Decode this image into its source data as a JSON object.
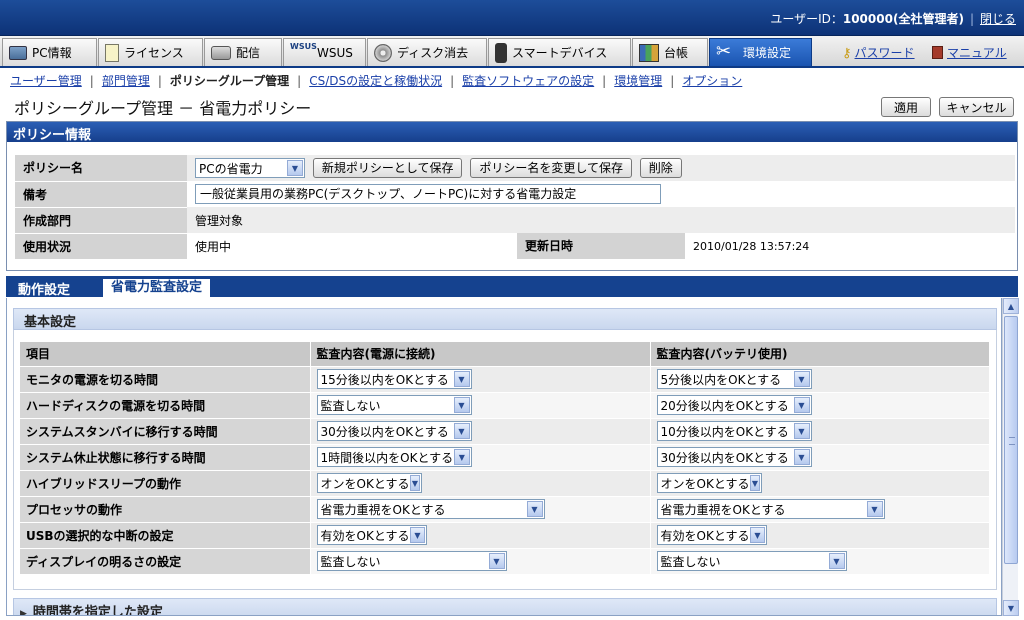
{
  "header": {
    "user_label": "ユーザーID：",
    "user_value": "100000(全社管理者)",
    "separator": "|",
    "close_label": "閉じる"
  },
  "tabs": [
    {
      "label": "PC情報",
      "icon": "pc-icon"
    },
    {
      "label": "ライセンス",
      "icon": "license-icon"
    },
    {
      "label": "配信",
      "icon": "distribution-icon"
    },
    {
      "label": "WSUS",
      "icon": "wsus-icon",
      "icon_text": "WSUS"
    },
    {
      "label": "ディスク消去",
      "icon": "disk-icon"
    },
    {
      "label": "スマートデバイス",
      "icon": "smart-device-icon"
    },
    {
      "label": "台帳",
      "icon": "ledger-icon"
    },
    {
      "label": "環境設定",
      "icon": "tools-icon",
      "active": true
    }
  ],
  "right_links": {
    "password": "パスワード",
    "manual": "マニュアル"
  },
  "subnav": {
    "items": [
      "ユーザー管理",
      "部門管理",
      "ポリシーグループ管理",
      "CS/DSの設定と稼働状況",
      "監査ソフトウェアの設定",
      "環境管理",
      "オプション"
    ],
    "current": "ポリシーグループ管理",
    "separator": "|"
  },
  "page": {
    "title": "ポリシーグループ管理 － 省電力ポリシー",
    "apply_label": "適用",
    "cancel_label": "キャンセル"
  },
  "policy_info": {
    "heading": "ポリシー情報",
    "name_label": "ポリシー名",
    "name_value": "PCの省電力",
    "save_new_label": "新規ポリシーとして保存",
    "rename_save_label": "ポリシー名を変更して保存",
    "delete_label": "削除",
    "remarks_label": "備考",
    "remarks_value": "一般従業員用の業務PC(デスクトップ、ノートPC)に対する省電力設定",
    "dept_label": "作成部門",
    "dept_value": "管理対象",
    "status_label": "使用状況",
    "status_value": "使用中",
    "updated_label": "更新日時",
    "updated_value": "2010/01/28 13:57:24"
  },
  "detail_tabs": {
    "op": "動作設定",
    "audit": "省電力監査設定"
  },
  "basic": {
    "heading": "基本設定",
    "col_item": "項目",
    "col_ac": "監査内容(電源に接続)",
    "col_battery": "監査内容(バッテリ使用)",
    "rows": [
      {
        "label": "モニタの電源を切る時間",
        "ac": "15分後以内をOKとする",
        "battery": "5分後以内をOKとする"
      },
      {
        "label": "ハードディスクの電源を切る時間",
        "ac": "監査しない",
        "battery": "20分後以内をOKとする"
      },
      {
        "label": "システムスタンバイに移行する時間",
        "ac": "30分後以内をOKとする",
        "battery": "10分後以内をOKとする"
      },
      {
        "label": "システム休止状態に移行する時間",
        "ac": "1時間後以内をOKとする",
        "battery": "30分後以内をOKとする"
      },
      {
        "label": "ハイブリッドスリープの動作",
        "ac": "オンをOKとする",
        "battery": "オンをOKとする"
      },
      {
        "label": "プロセッサの動作",
        "ac": "省電力重視をOKとする",
        "battery": "省電力重視をOKとする"
      },
      {
        "label": "USBの選択的な中断の設定",
        "ac": "有効をOKとする",
        "battery": "有効をOKとする"
      },
      {
        "label": "ディスプレイの明るさの設定",
        "ac": "監査しない",
        "battery": "監査しない"
      }
    ]
  },
  "timeslot": {
    "heading": "時間帯を指定した設定"
  }
}
